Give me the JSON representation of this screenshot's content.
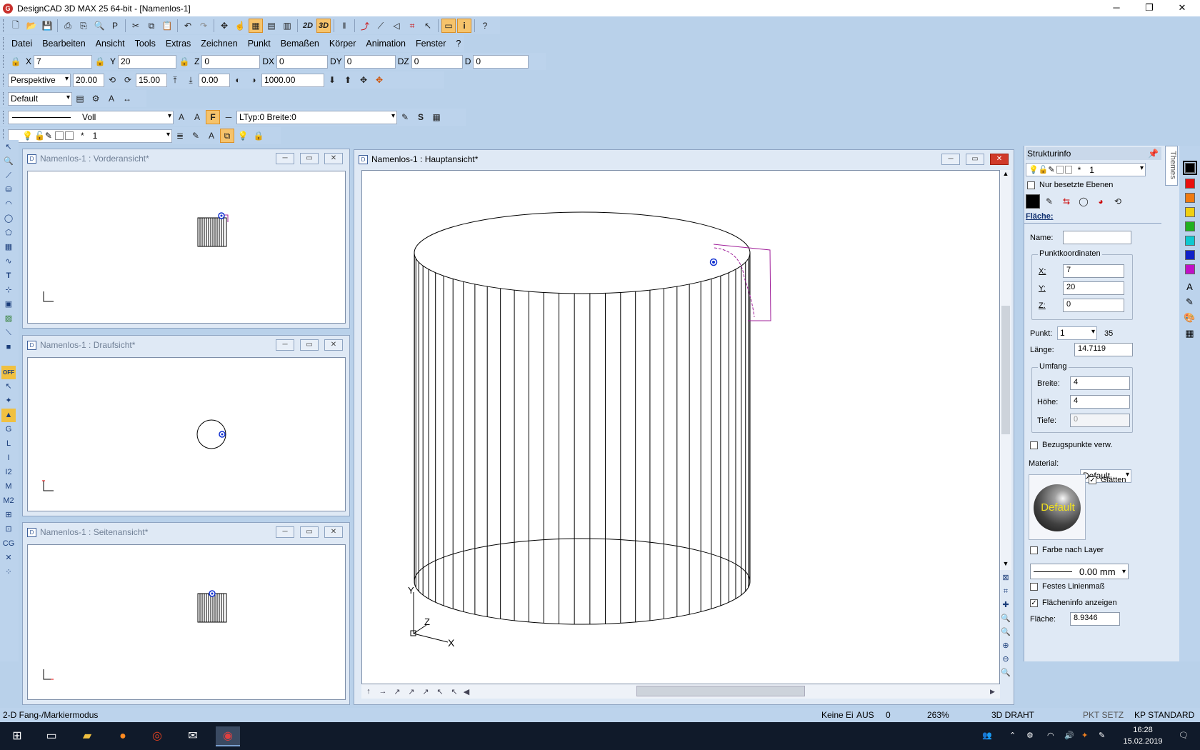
{
  "window": {
    "title": "DesignCAD 3D MAX 25 64-bit - [Namenlos-1]",
    "app_icon": "designcad-logo"
  },
  "menu": [
    "Datei",
    "Bearbeiten",
    "Ansicht",
    "Tools",
    "Extras",
    "Zeichnen",
    "Punkt",
    "Bemaßen",
    "Körper",
    "Animation",
    "Fenster",
    "?"
  ],
  "coords": {
    "x_label": "X",
    "x": "7",
    "y_label": "Y",
    "y": "20",
    "z_label": "Z",
    "z": "0",
    "dx_label": "DX",
    "dx": "0",
    "dy_label": "DY",
    "dy": "0",
    "dz_label": "DZ",
    "dz": "0",
    "d_label": "D",
    "d": "0"
  },
  "view_toolbar": {
    "projection": "Perspektive",
    "v1": "20.00",
    "v2": "15.00",
    "v3": "0.00",
    "v4": "1000.00"
  },
  "style_toolbar": {
    "style": "Default"
  },
  "line_toolbar": {
    "line_style": "Voll",
    "ltype": "LTyp:0  Breite:0",
    "f_label": "F"
  },
  "layer_toolbar": {
    "star": "*",
    "layer": "1"
  },
  "toolbar_2d": "2D",
  "toolbar_3d": "3D",
  "views": {
    "front": {
      "title": "Namenlos-1 : Vorderansicht*"
    },
    "top": {
      "title": "Namenlos-1 : Draufsicht*"
    },
    "side": {
      "title": "Namenlos-1 : Seitenansicht*"
    },
    "main": {
      "title": "Namenlos-1 : Hauptansicht*"
    }
  },
  "axes": {
    "x": "X",
    "y": "Y",
    "z": "Z"
  },
  "panel": {
    "title": "Strukturinfo",
    "themes_tab": "Themes",
    "layer_star": "*",
    "layer_num": "1",
    "only_used_layers": "Nur besetzte Ebenen",
    "section": "Fläche:",
    "name_label": "Name:",
    "name_value": "",
    "coords_group": "Punktkoordinaten",
    "x_label": "X:",
    "x": "7",
    "y_label": "Y:",
    "y": "20",
    "z_label": "Z:",
    "z": "0",
    "punkt_label": "Punkt:",
    "punkt": "1",
    "punkt_total": "35",
    "laenge_label": "Länge:",
    "laenge": "14.7119",
    "umfang_group": "Umfang",
    "breite_label": "Breite:",
    "breite": "4",
    "hoehe_label": "Höhe:",
    "hoehe": "4",
    "tiefe_label": "Tiefe:",
    "tiefe": "0",
    "bezug": "Bezugspunkte verw.",
    "material_label": "Material:",
    "material": "Default",
    "glaetten": "Glätten",
    "sphere_label": "Default",
    "farbe_layer": "Farbe nach Layer",
    "line_width": "0.00 mm",
    "festes": "Festes Linienmaß",
    "flaecheninfo": "Flächeninfo anzeigen",
    "flaeche_label": "Fläche:",
    "flaeche": "8.9346"
  },
  "palette": [
    "#000000",
    "#e81010",
    "#f07a10",
    "#f0d010",
    "#20b020",
    "#10c8d0",
    "#1020c8",
    "#c010c8"
  ],
  "status": {
    "mode": "2-D Fang-/Markiermodus",
    "keine": "Keine Ei",
    "aus": "AUS",
    "zero": "0",
    "zoom": "263%",
    "draht": "3D DRAHT",
    "pkt": "PKT SETZ",
    "kp": "KP STANDARD"
  },
  "taskbar": {
    "time": "16:28",
    "date": "15.02.2019"
  }
}
